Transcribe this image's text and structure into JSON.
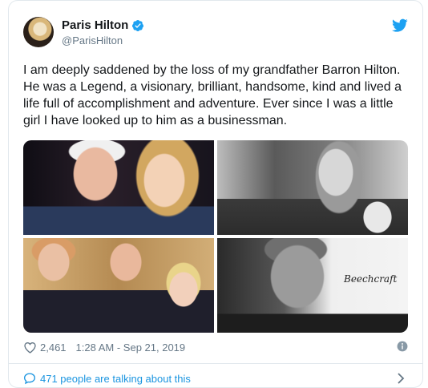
{
  "tweet": {
    "author": {
      "display_name": "Paris Hilton",
      "handle": "@ParisHilton",
      "verified": true
    },
    "text": "I am deeply saddened by the loss of my grandfather Barron Hilton. He was a Legend, a visionary, brilliant, handsome, kind and lived a life full of accomplishment and adventure. Ever since I was a little girl I have looked up to him as a businessman.",
    "media_watermark": "Beechcraft",
    "likes": "2,461",
    "timestamp": "1:28 AM - Sep 21, 2019",
    "talking_about": "471 people are talking about this"
  },
  "colors": {
    "accent": "#1da1f2",
    "link": "#1b95e0",
    "muted": "#657786",
    "text": "#14171a",
    "border": "#e1e8ed"
  },
  "icons": {
    "verified": "verified-badge-icon",
    "brand": "twitter-bird-icon",
    "like": "heart-outline-icon",
    "info": "info-circle-icon",
    "conversation": "speech-bubble-icon",
    "navigate": "chevron-right-icon"
  }
}
